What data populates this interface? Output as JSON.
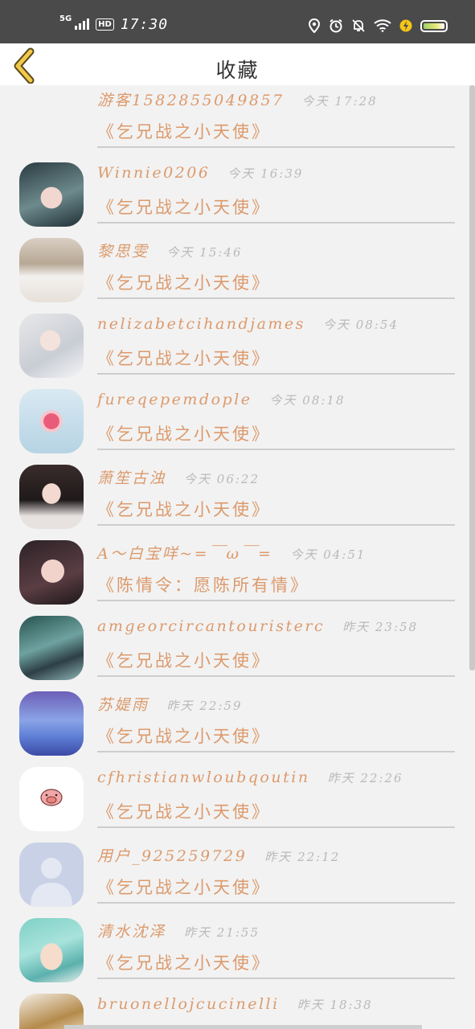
{
  "status_bar": {
    "network": "5G",
    "hd_badge": "HD",
    "time": "17:30"
  },
  "header": {
    "title": "收藏"
  },
  "colors": {
    "accent": "#dc9a6c",
    "time_text": "#b9b9b9",
    "status_bar_bg": "#4a4a4a",
    "divider": "#cdcdcd"
  },
  "favorites": [
    {
      "name": "游客15828550498​57",
      "time": "今天 17:28",
      "work": "《乞兄战之小天使》",
      "avatar": "none"
    },
    {
      "name": "Winnie0206",
      "time": "今天 16:39",
      "work": "《乞兄战之小天使》",
      "avatar": "girl-glasses"
    },
    {
      "name": "黎思雯",
      "time": "今天 15:46",
      "work": "《乞兄战之小天使》",
      "avatar": "wedding-photo"
    },
    {
      "name": "nelizabetcihandjames",
      "time": "今天 08:54",
      "work": "《乞兄战之小天使》",
      "avatar": "sleeping-girl"
    },
    {
      "name": "fureqepemdople",
      "time": "今天 08:18",
      "work": "《乞兄战之小天使》",
      "avatar": "pink-pendant"
    },
    {
      "name": "萧笙古浊",
      "time": "今天 06:22",
      "work": "《乞兄战之小天使》",
      "avatar": "drawn-girl"
    },
    {
      "name": "A～白宝咩~=￣ω￣=",
      "time": "今天 04:51",
      "work": "《陈情令：愿陈所有情》",
      "avatar": "selfie-girl"
    },
    {
      "name": "amgeorcircantouristerc",
      "time": "昨天 23:58",
      "work": "《乞兄战之小天使》",
      "avatar": "forest-scene"
    },
    {
      "name": "苏媞雨",
      "time": "昨天 22:59",
      "work": "《乞兄战之小天使》",
      "avatar": "deer-scene"
    },
    {
      "name": "cfhristianwloubqoutin",
      "time": "昨天 22:26",
      "work": "《乞兄战之小天使》",
      "avatar": "pig-sticker"
    },
    {
      "name": "用户_925259729",
      "time": "昨天 22:12",
      "work": "《乞兄战之小天使》",
      "avatar": "default-person"
    },
    {
      "name": "清水沈泽",
      "time": "昨天 21:55",
      "work": "《乞兄战之小天使》",
      "avatar": "anime-boy"
    },
    {
      "name": "bruonellojcucinelli",
      "time": "昨天 18:38",
      "work": "",
      "avatar": "instrument"
    }
  ]
}
